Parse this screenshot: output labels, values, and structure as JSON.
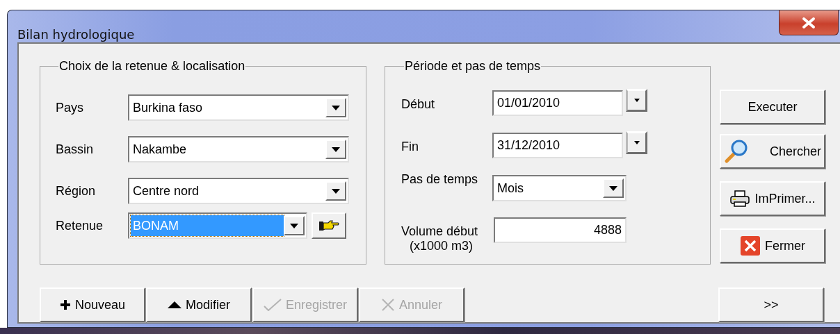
{
  "window": {
    "title": "Bilan hydrologique"
  },
  "location_group": {
    "title": "Choix de la retenue & localisation",
    "fields": [
      {
        "kind": "combo",
        "label": "Pays",
        "value": "Burkina faso",
        "highlighted": false
      },
      {
        "kind": "combo",
        "label": "Bassin",
        "value": "Nakambe",
        "highlighted": false
      },
      {
        "kind": "combo",
        "label": "Région",
        "value": "Centre nord",
        "highlighted": false
      },
      {
        "kind": "combo_pick",
        "label": "Retenue",
        "value": "BONAM",
        "highlighted": true
      }
    ]
  },
  "period_group": {
    "title": "Période et pas de temps",
    "fields": [
      {
        "kind": "date",
        "label": "Début",
        "value": "01/01/2010"
      },
      {
        "kind": "date",
        "label": "Fin",
        "value": "31/12/2010"
      },
      {
        "kind": "combo",
        "label": "Pas de temps",
        "value": "Mois"
      },
      {
        "kind": "number",
        "label": "Volume début",
        "sublabel": "(x1000 m3)",
        "value": "4888"
      }
    ]
  },
  "side_buttons": [
    {
      "kind": "plain",
      "label": "Executer"
    },
    {
      "kind": "search",
      "label": "Chercher"
    },
    {
      "kind": "print",
      "label": "ImPrimer..."
    },
    {
      "kind": "close",
      "label": "Fermer"
    }
  ],
  "bottom_buttons": [
    {
      "kind": "add",
      "label": "Nouveau",
      "disabled": false
    },
    {
      "kind": "up",
      "label": "Modifier",
      "disabled": false
    },
    {
      "kind": "save",
      "label": "Enregistrer",
      "disabled": true
    },
    {
      "kind": "cancel",
      "label": "Annuler",
      "disabled": true
    }
  ],
  "more_button": {
    "label": ">>"
  }
}
